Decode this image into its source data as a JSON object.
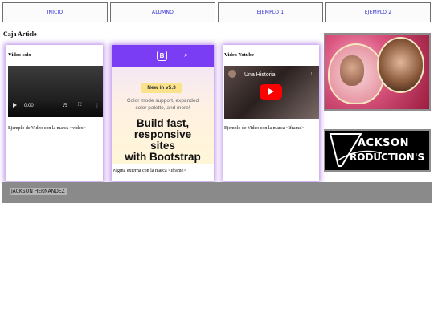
{
  "nav": {
    "items": [
      {
        "label": "INICIO"
      },
      {
        "label": "ALUMNO"
      },
      {
        "label": "EJEMPLO 1"
      },
      {
        "label": "EJEMPLO 2"
      }
    ]
  },
  "section": {
    "title": "Caja Article"
  },
  "cards": [
    {
      "title": "Video solo",
      "description": "Ejemplo de Video con la marca <video>",
      "video": {
        "time": "0:00"
      }
    },
    {
      "description": "Página externa con la marca <iframe>",
      "embed": {
        "badge": "New in v5.3",
        "subtitle_line1": "Color mode support, expanded",
        "subtitle_line2": "color palette, and more!",
        "headline_line1": "Build fast,",
        "headline_line2": "responsive",
        "headline_line3": "sites",
        "headline_line4": "with Bootstrap"
      }
    },
    {
      "title": "Video Yotube",
      "description": "Ejemplo de Video con la marca <iframe>",
      "youtube": {
        "video_title": "Una Historia"
      }
    }
  ],
  "sidebar": {
    "logo_line1": "ACKSON",
    "logo_line2": "RODUCTION'S"
  },
  "footer": {
    "text": "JACKSON HERNANDEZ"
  },
  "colors": {
    "accent_shadow": "#8c3cdc",
    "bootstrap_purple": "#7b3df3",
    "youtube_red": "#ff0000",
    "footer_bg": "#8a8a8a"
  }
}
